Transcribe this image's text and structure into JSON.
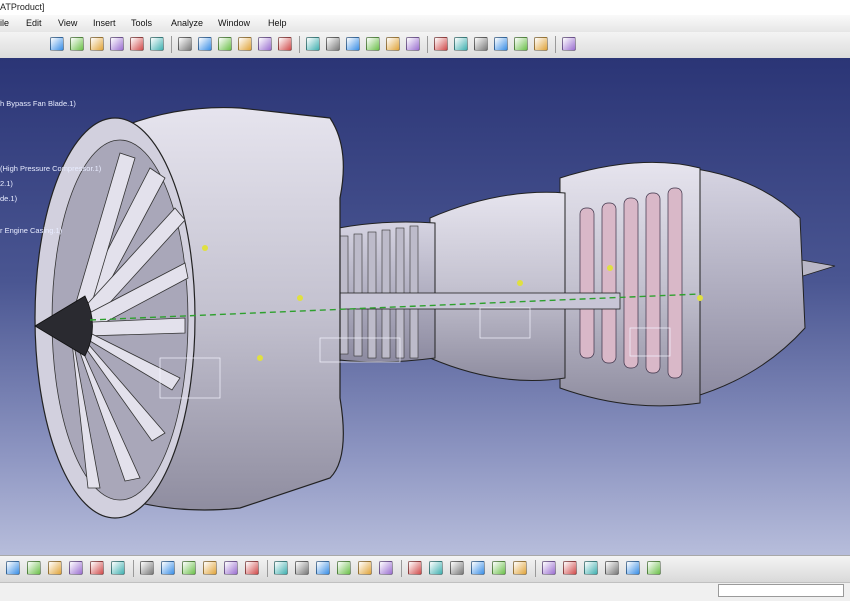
{
  "window": {
    "title": "ATProduct]"
  },
  "menu": [
    "ile",
    "Edit",
    "View",
    "Insert",
    "Tools",
    "Analyze",
    "Window",
    "Help"
  ],
  "tree": [
    "h Bypass Fan Blade.1)",
    "(High Pressure Compressor.1)",
    "2.1)",
    "de.1)",
    "r Engine Casing.1)"
  ],
  "toolbar_top": [
    "view-front-icon",
    "view-back-icon",
    "view-left-icon",
    "view-right-icon",
    "view-top-icon",
    "view-bottom-icon",
    "view-iso-icon",
    "named-views-icon",
    "assembly-icon",
    "product-icon",
    "part-icon",
    "component-icon",
    "snap-icon",
    "move-icon",
    "compass-icon",
    "manipulate-icon",
    "explode-icon",
    "constraint-icon",
    "fix-icon",
    "contact-icon",
    "offset-icon",
    "angle-icon",
    "update-icon",
    "catalog-icon",
    "tools-icon"
  ],
  "toolbar_bottom": [
    "new-icon",
    "undo-icon",
    "redo-icon",
    "whats-this-icon",
    "formula-icon",
    "knowledge-icon",
    "table-icon",
    "tree-expand-icon",
    "hide-show-icon",
    "swap-icon",
    "fit-all-icon",
    "pan-icon",
    "rotate-icon",
    "zoom-in-icon",
    "zoom-out-icon",
    "normal-view-icon",
    "iso-view-icon",
    "shading-icon",
    "hidden-lines-icon",
    "measure-icon",
    "measure-item-icon",
    "clash-icon",
    "section-icon",
    "render-icon",
    "save-management-icon",
    "scene-icon",
    "selection-icon",
    "materials-icon",
    "publish-icon",
    "apply-material-icon"
  ],
  "colors": {
    "accent": "#1b6fd1",
    "viewport_top": "#2b3576",
    "viewport_bottom": "#b7bddb",
    "part_fill": "#c9c7d4",
    "constraint": "#e0e040",
    "axis": "#2ea02e"
  }
}
